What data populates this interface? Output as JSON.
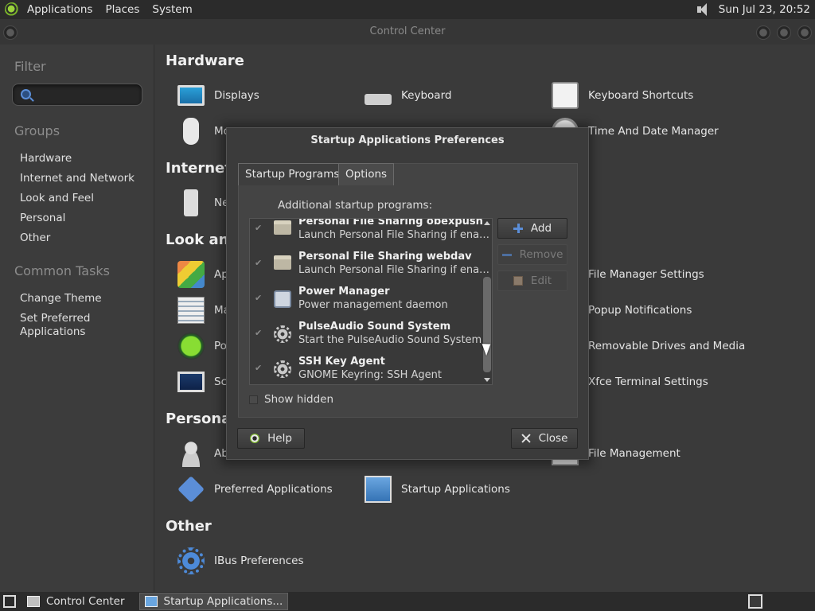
{
  "top_panel": {
    "menus": [
      "Applications",
      "Places",
      "System"
    ],
    "clock": "Sun Jul 23, 20:52"
  },
  "window": {
    "title": "Control Center"
  },
  "sidebar": {
    "filter_heading": "Filter",
    "search_placeholder": "",
    "groups_heading": "Groups",
    "groups": [
      "Hardware",
      "Internet and Network",
      "Look and Feel",
      "Personal",
      "Other"
    ],
    "common_tasks_heading": "Common Tasks",
    "common_tasks": [
      "Change Theme",
      "Set Preferred\nApplications"
    ]
  },
  "main": {
    "hardware": {
      "title": "Hardware",
      "items": [
        "Displays",
        "Keyboard",
        "Keyboard Shortcuts",
        "Mo",
        "Time And Date Manager"
      ]
    },
    "internet": {
      "title": "Internet",
      "items": [
        "Ne"
      ]
    },
    "look": {
      "title": "Look and",
      "items": [
        "Ap",
        "File Manager Settings",
        "Ma",
        "Popup Notifications",
        "Po",
        "Removable Drives and Media",
        "Sc",
        "Xfce Terminal Settings"
      ]
    },
    "personal": {
      "title": "Personal",
      "items": [
        "Ab",
        "File Management",
        "Preferred Applications",
        "Startup Applications"
      ]
    },
    "other": {
      "title": "Other",
      "items": [
        "IBus Preferences"
      ]
    }
  },
  "dialog": {
    "title": "Startup Applications Preferences",
    "tabs": [
      "Startup Programs",
      "Options"
    ],
    "list_label": "Additional startup programs:",
    "programs": [
      {
        "name": "Personal File Sharing obexpush",
        "desc": "Launch Personal File Sharing if ena…",
        "icon": "folder-icon"
      },
      {
        "name": "Personal File Sharing webdav",
        "desc": "Launch Personal File Sharing if ena…",
        "icon": "folder-icon"
      },
      {
        "name": "Power Manager",
        "desc": "Power management daemon",
        "icon": "power-manager-icon"
      },
      {
        "name": "PulseAudio Sound System",
        "desc": "Start the PulseAudio Sound System",
        "icon": "gear-icon"
      },
      {
        "name": "SSH Key Agent",
        "desc": "GNOME Keyring: SSH Agent",
        "icon": "gear-icon"
      }
    ],
    "add_label": "Add",
    "remove_label": "Remove",
    "edit_label": "Edit",
    "show_hidden_label": "Show hidden",
    "help_label": "Help",
    "close_label": "Close"
  },
  "taskbar": {
    "tasks": [
      "Control Center",
      "Startup Applications..."
    ]
  },
  "colors": {
    "panel": "#2b2b2b",
    "window_bg": "#3a3a3a",
    "accent": "#5b8ed8"
  }
}
